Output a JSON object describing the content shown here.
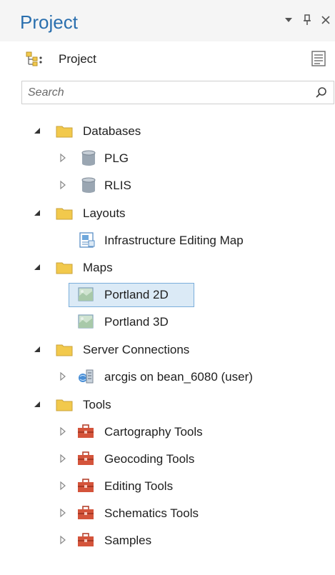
{
  "panel": {
    "title": "Project",
    "controls": {
      "dropdown_glyph": "▾",
      "pin_glyph": "𝟭",
      "close_glyph": "✕"
    }
  },
  "breadcrumb": {
    "label": "Project",
    "icon": "project-tree-icon"
  },
  "search": {
    "placeholder": "Search",
    "value": ""
  },
  "tree": {
    "databases": {
      "label": "Databases",
      "expanded": true,
      "children": {
        "plg": "PLG",
        "rlis": "RLIS"
      }
    },
    "layouts": {
      "label": "Layouts",
      "expanded": true,
      "children": {
        "infra": "Infrastructure Editing Map"
      }
    },
    "maps": {
      "label": "Maps",
      "expanded": true,
      "children": {
        "portland2d": "Portland 2D",
        "portland3d": "Portland 3D"
      },
      "selected": "Portland 2D"
    },
    "server": {
      "label": "Server Connections",
      "expanded": true,
      "children": {
        "arcgis": "arcgis on bean_6080 (user)"
      }
    },
    "tools": {
      "label": "Tools",
      "expanded": true,
      "children": {
        "cartography": "Cartography Tools",
        "geocoding": "Geocoding Tools",
        "editing": "Editing Tools",
        "schematics": "Schematics Tools",
        "samples": "Samples"
      }
    }
  },
  "colors": {
    "title": "#2a6fae",
    "folder": "#f2c94c",
    "toolbox": "#d4543b",
    "selection_bg": "#dbeaf6",
    "selection_border": "#7aaedb"
  }
}
